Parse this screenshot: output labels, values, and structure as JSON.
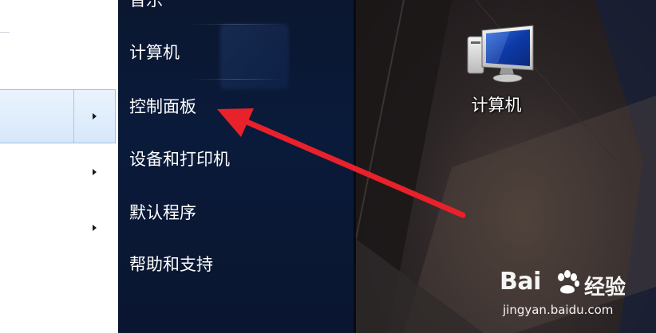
{
  "start_menu": {
    "right_items": {
      "top_cut": "音乐",
      "computer": "计算机",
      "control_panel": "控制面板",
      "devices_printers": "设备和打印机",
      "default_programs": "默认程序",
      "help_support": "帮助和支持"
    }
  },
  "desktop": {
    "computer_icon_label": "计算机"
  },
  "watermark": {
    "brand_text": "Bai",
    "product_text": "经验",
    "url": "jingyan.baidu.com"
  },
  "colors": {
    "annotation_arrow": "#e8212b",
    "menu_background": "#0a1a3a",
    "highlight": "#d7e8fb"
  }
}
